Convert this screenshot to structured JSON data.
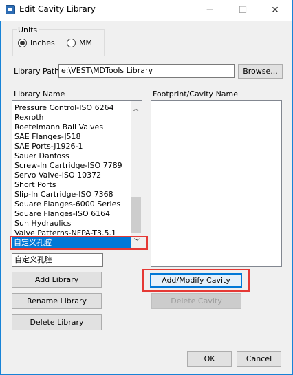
{
  "window": {
    "title": "Edit Cavity Library",
    "controls": {
      "minimize": "─",
      "maximize": "☐",
      "close": "✕"
    }
  },
  "units": {
    "label": "Units",
    "options": [
      {
        "label": "Inches",
        "selected": true
      },
      {
        "label": "MM",
        "selected": false
      }
    ]
  },
  "library_path": {
    "label": "Library Path",
    "value": "e:\\VEST\\MDTools Library",
    "browse_label": "Browse..."
  },
  "library_list": {
    "label": "Library Name",
    "items": [
      "Pressure Control-ISO 6264",
      "Rexroth",
      "Roetelmann Ball Valves",
      "SAE Flanges-J518",
      "SAE Ports-J1926-1",
      "Sauer Danfoss",
      "Screw-In Cartridge-ISO 7789",
      "Servo Valve-ISO 10372",
      "Short Ports",
      "Slip-In Cartridge-ISO 7368",
      "Square Flanges-6000 Series",
      "Square Flanges-ISO 6164",
      "Sun Hydraulics",
      "Valve Patterns-NFPA-T3.5.1"
    ],
    "selected_item": "自定义孔腔",
    "name_input_value": "自定义孔腔"
  },
  "footprint": {
    "label": "Footprint/Cavity Name"
  },
  "buttons": {
    "add_library": "Add Library",
    "rename_library": "Rename Library",
    "delete_library": "Delete Library",
    "add_modify_cavity": "Add/Modify Cavity",
    "delete_cavity": "Delete Cavity",
    "ok": "OK",
    "cancel": "Cancel"
  },
  "colors": {
    "highlight_box": "#e53935",
    "selection": "#0078d7",
    "accent": "#1883d7"
  }
}
